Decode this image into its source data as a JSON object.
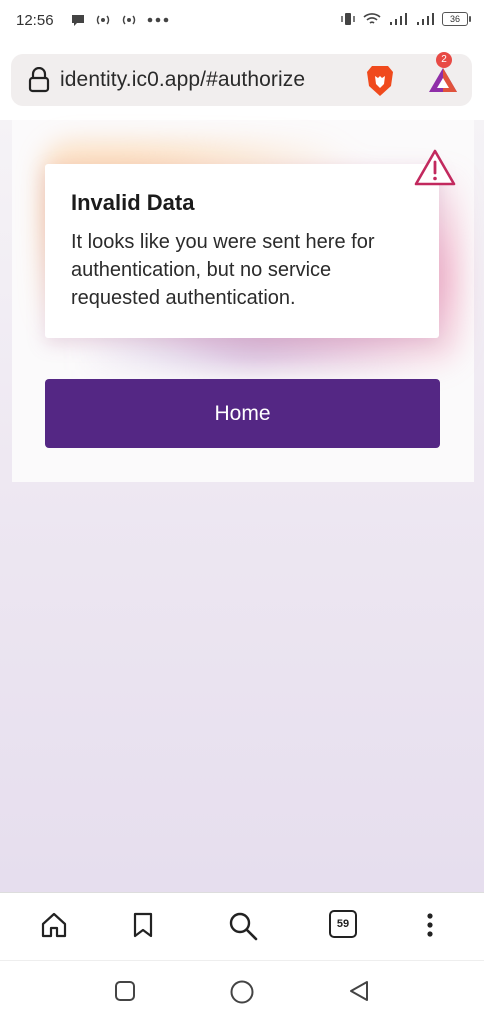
{
  "status_bar": {
    "time": "12:56",
    "left_icons": [
      "chat-bubble-icon",
      "hotspot-icon",
      "hotspot-icon",
      "more-dots-icon"
    ],
    "right_icons": [
      "vibrate-icon",
      "wifi-icon",
      "signal-icon",
      "signal-icon"
    ],
    "battery": "36"
  },
  "browser": {
    "url": "identity.ic0.app/#authorize",
    "rewards_badge": "2",
    "icons": [
      "lock-icon",
      "brave-lion-icon",
      "brave-rewards-icon"
    ]
  },
  "card": {
    "title": "Invalid Data",
    "message": "It looks like you were sent here for authentication, but no service requested authentication.",
    "icon": "warning-icon"
  },
  "actions": {
    "home_label": "Home"
  },
  "toolbar": {
    "tabs_count": "59",
    "icons": [
      "home-icon",
      "bookmark-icon",
      "search-icon",
      "tabs-icon",
      "menu-icon"
    ]
  },
  "android_nav": {
    "icons": [
      "recents-icon",
      "home-circle-icon",
      "back-icon"
    ]
  },
  "colors": {
    "button": "#542784",
    "warning": "#c2295e",
    "badge": "#e84a45"
  }
}
